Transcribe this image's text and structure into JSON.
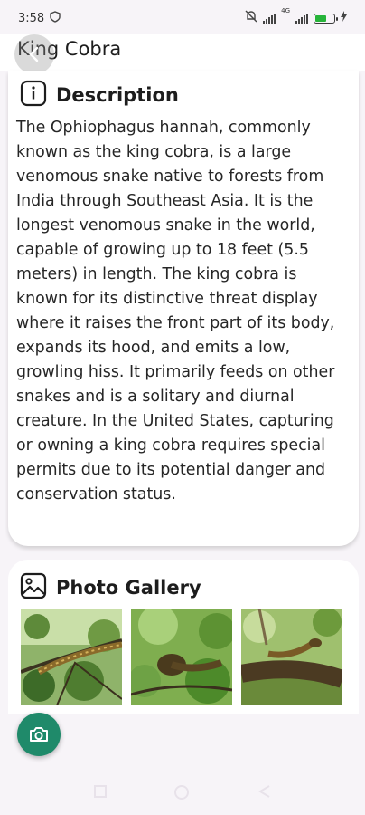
{
  "status_bar": {
    "time": "3:58",
    "network_label": "4G"
  },
  "header": {
    "title": "King Cobra"
  },
  "description": {
    "title": "Description",
    "text": "The Ophiophagus hannah, commonly known as the king cobra, is a large venomous snake native to forests from India through Southeast Asia. It is the longest venomous snake in the world, capable of growing up to 18 feet (5.5 meters) in length. The king cobra is known for its distinctive threat display where it raises the front part of its body, expands its hood, and emits a low, growling hiss. It primarily feeds on other snakes and is a solitary and diurnal creature. In the United States, capturing or owning a king cobra requires special permits due to its potential danger and conservation status."
  },
  "gallery": {
    "title": "Photo Gallery",
    "photos": [
      "snake-on-branch",
      "snake-head-in-leaves",
      "snake-coiled-on-branch"
    ]
  },
  "colors": {
    "accent": "#1f8a6a",
    "battery": "#27b43a"
  }
}
